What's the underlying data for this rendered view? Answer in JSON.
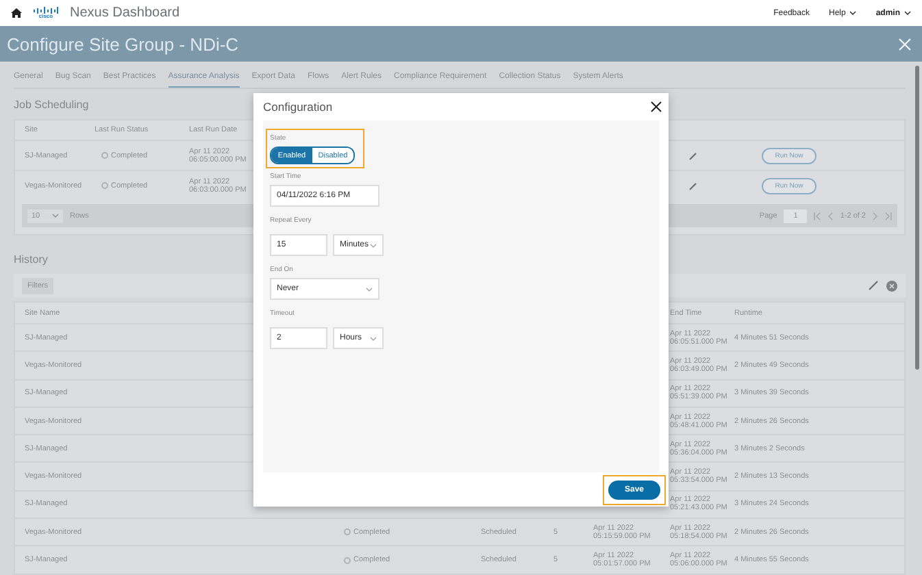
{
  "header": {
    "logo": "cisco",
    "title": "Nexus Dashboard",
    "links": [
      {
        "label": "Feedback",
        "dropdown": false
      },
      {
        "label": "Help",
        "dropdown": true
      },
      {
        "label": "admin",
        "dropdown": true
      }
    ]
  },
  "title_bar": {
    "title": "Configure Site Group - NDi-C"
  },
  "tabs": [
    {
      "label": "General",
      "selected": false
    },
    {
      "label": "Bug Scan",
      "selected": false
    },
    {
      "label": "Best Practices",
      "selected": false
    },
    {
      "label": "Assurance Analysis",
      "selected": true
    },
    {
      "label": "Export Data",
      "selected": false
    },
    {
      "label": "Flows",
      "selected": false
    },
    {
      "label": "Alert Rules",
      "selected": false
    },
    {
      "label": "Compliance Requirement",
      "selected": false
    },
    {
      "label": "Collection Status",
      "selected": false
    },
    {
      "label": "System Alerts",
      "selected": false
    }
  ],
  "job_scheduling": {
    "heading": "Job Scheduling",
    "columns": [
      "Site",
      "Last Run Status",
      "Last Run Date"
    ],
    "rows": [
      {
        "site": "SJ-Managed",
        "status": "Completed",
        "date": "Apr 11 2022",
        "time": "06:05:00.000 PM",
        "action": "Run Now"
      },
      {
        "site": "Vegas-Monitored",
        "status": "Completed",
        "date": "Apr 11 2022",
        "time": "06:03:00.000 PM",
        "action": "Run Now"
      }
    ],
    "pagination": {
      "rows_per_page": "10",
      "rows_label": "Rows",
      "page_label": "Page",
      "page": "1",
      "range": "1-2 of 2"
    }
  },
  "history": {
    "heading": "History",
    "filter": "Filters",
    "columns": [
      "Site Name",
      "End Time",
      "Runtime"
    ],
    "rows": [
      {
        "site": "SJ-Managed",
        "end_date": "Apr 11 2022",
        "end_time": "06:05:51.000 PM",
        "runtime": "4 Minutes 51 Seconds"
      },
      {
        "site": "Vegas-Monitored",
        "end_date": "Apr 11 2022",
        "end_time": "06:03:49.000 PM",
        "runtime": "2 Minutes 49 Seconds"
      },
      {
        "site": "SJ-Managed",
        "end_date": "Apr 11 2022",
        "end_time": "05:51:39.000 PM",
        "runtime": "3 Minutes 39 Seconds"
      },
      {
        "site": "Vegas-Monitored",
        "end_date": "Apr 11 2022",
        "end_time": "05:48:41.000 PM",
        "runtime": "2 Minutes 26 Seconds"
      },
      {
        "site": "SJ-Managed",
        "end_date": "Apr 11 2022",
        "end_time": "05:36:04.000 PM",
        "runtime": "3 Minutes 2 Seconds"
      },
      {
        "site": "Vegas-Monitored",
        "end_date": "Apr 11 2022",
        "end_time": "05:33:54.000 PM",
        "runtime": "2 Minutes 13 Seconds"
      },
      {
        "site": "SJ-Managed",
        "end_date": "Apr 11 2022",
        "end_time": "05:21:43.000 PM",
        "runtime": "3 Minutes 24 Seconds"
      },
      {
        "site": "Vegas-Monitored",
        "status": "Completed",
        "type": "Scheduled",
        "count": "5",
        "start_date": "Apr 11 2022",
        "start_time": "05:15:59.000 PM",
        "end_date": "Apr 11 2022",
        "end_time": "05:18:54.000 PM",
        "runtime": "2 Minutes 26 Seconds"
      },
      {
        "site": "SJ-Managed",
        "status": "Completed",
        "type": "Scheduled",
        "count": "5",
        "start_date": "Apr 11 2022",
        "start_time": "05:01:57.000 PM",
        "end_date": "Apr 11 2022",
        "end_time": "05:06:00.000 PM",
        "runtime": "4 Minutes 55 Seconds"
      }
    ]
  },
  "dialog": {
    "title": "Configuration",
    "fields": [
      {
        "kind": "toggle",
        "label": "State",
        "highlighted": true,
        "options": [
          {
            "label": "Enabled",
            "selected": true
          },
          {
            "label": "Disabled",
            "selected": false
          }
        ]
      },
      {
        "kind": "text",
        "label": "Start Time",
        "value": "04/11/2022 6:16 PM"
      },
      {
        "kind": "number_unit",
        "label": "Repeat Every",
        "value": "15",
        "unit": "Minutes"
      },
      {
        "kind": "select",
        "label": "End On",
        "value": "Never"
      },
      {
        "kind": "number_unit",
        "label": "Timeout",
        "value": "2",
        "unit": "Hours"
      }
    ],
    "save": {
      "label": "Save",
      "highlighted": true
    }
  }
}
